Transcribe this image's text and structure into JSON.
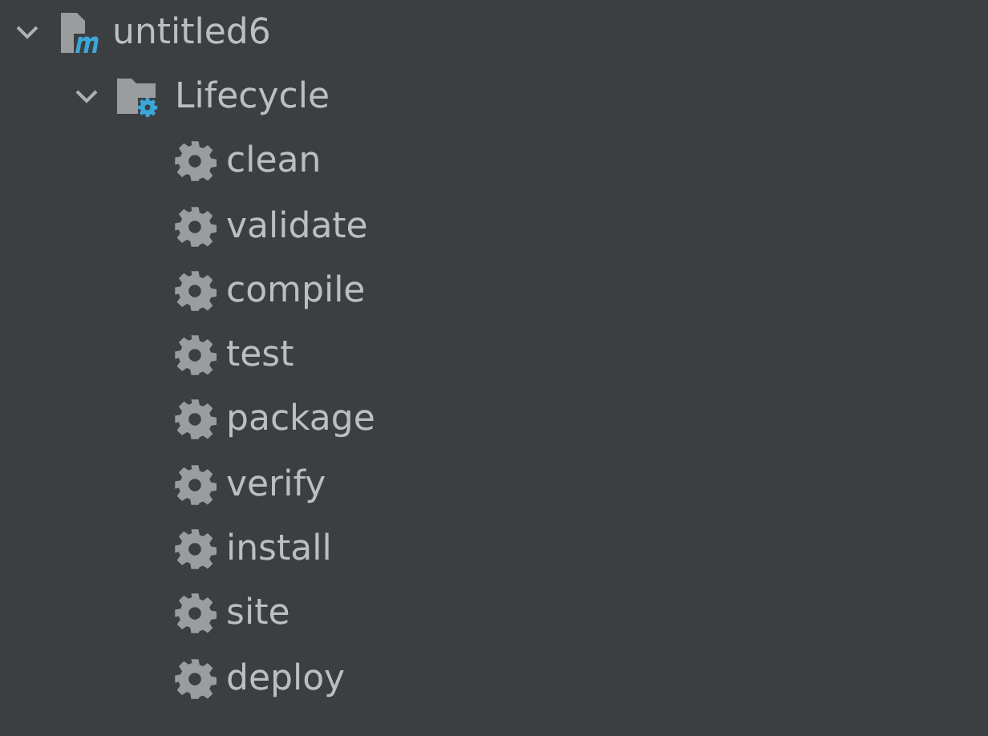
{
  "tree": [
    {
      "label": "untitled6",
      "kind": "project",
      "expanded": true,
      "children": [
        {
          "label": "Lifecycle",
          "kind": "folder",
          "expanded": true,
          "children": [
            {
              "label": "clean",
              "kind": "goal"
            },
            {
              "label": "validate",
              "kind": "goal"
            },
            {
              "label": "compile",
              "kind": "goal"
            },
            {
              "label": "test",
              "kind": "goal"
            },
            {
              "label": "package",
              "kind": "goal"
            },
            {
              "label": "verify",
              "kind": "goal"
            },
            {
              "label": "install",
              "kind": "goal"
            },
            {
              "label": "site",
              "kind": "goal"
            },
            {
              "label": "deploy",
              "kind": "goal"
            }
          ]
        }
      ]
    }
  ]
}
